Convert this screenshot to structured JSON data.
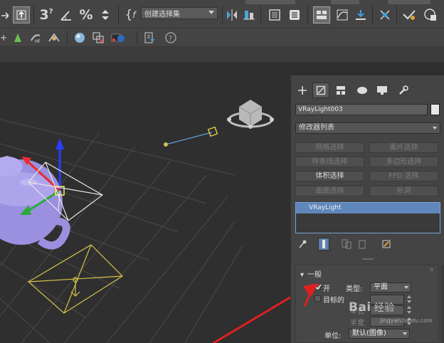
{
  "toolbar": {
    "selection_set_value": "创建选择集",
    "icons": [
      "select-move-icon",
      "select-object-icon",
      "snap-3d-icon",
      "angle-snap-icon",
      "percent-snap-icon",
      "spinner-snap-icon",
      "edit-named-selection-icon",
      "mirror-icon",
      "align-icon",
      "layer-manager-icon",
      "ribbon-icon",
      "scene-explorer-icon",
      "curve-editor-icon",
      "schematic-view-icon",
      "material-editor-icon",
      "render-setup-icon",
      "render-frame-icon",
      "render-icon"
    ]
  },
  "toolbar2": {
    "help_icon": "help-icon"
  },
  "command_panel": {
    "tabs": [
      "create-tab",
      "modify-tab",
      "hierarchy-tab",
      "motion-tab",
      "display-tab",
      "utilities-tab"
    ],
    "object_name": "VRayLight003",
    "object_color": "#e6e6e6",
    "modifier_list_label": "修改器列表",
    "modifier_buttons": [
      {
        "label": "网格选择",
        "enabled": false
      },
      {
        "label": "面片选择",
        "enabled": false
      },
      {
        "label": "样条线选择",
        "enabled": false
      },
      {
        "label": "多边形选择",
        "enabled": false
      },
      {
        "label": "体积选择",
        "enabled": true
      },
      {
        "label": "FFD 选择",
        "enabled": false
      },
      {
        "label": "曲面选择",
        "enabled": false
      },
      {
        "label": "补洞",
        "enabled": false
      }
    ],
    "stack_item": "VRayLight",
    "rollout": {
      "title": "一般",
      "on_label": "开",
      "type_label": "类型:",
      "type_value": "平面",
      "targeted_label": "目标的",
      "half_length_label": "半长",
      "half_width_label": "半宽",
      "units_label": "单位:",
      "units_value": "默认(图像)"
    }
  },
  "watermark": {
    "text": "Bai",
    "text2": "经验",
    "url": "jingyan.baidu.com"
  }
}
